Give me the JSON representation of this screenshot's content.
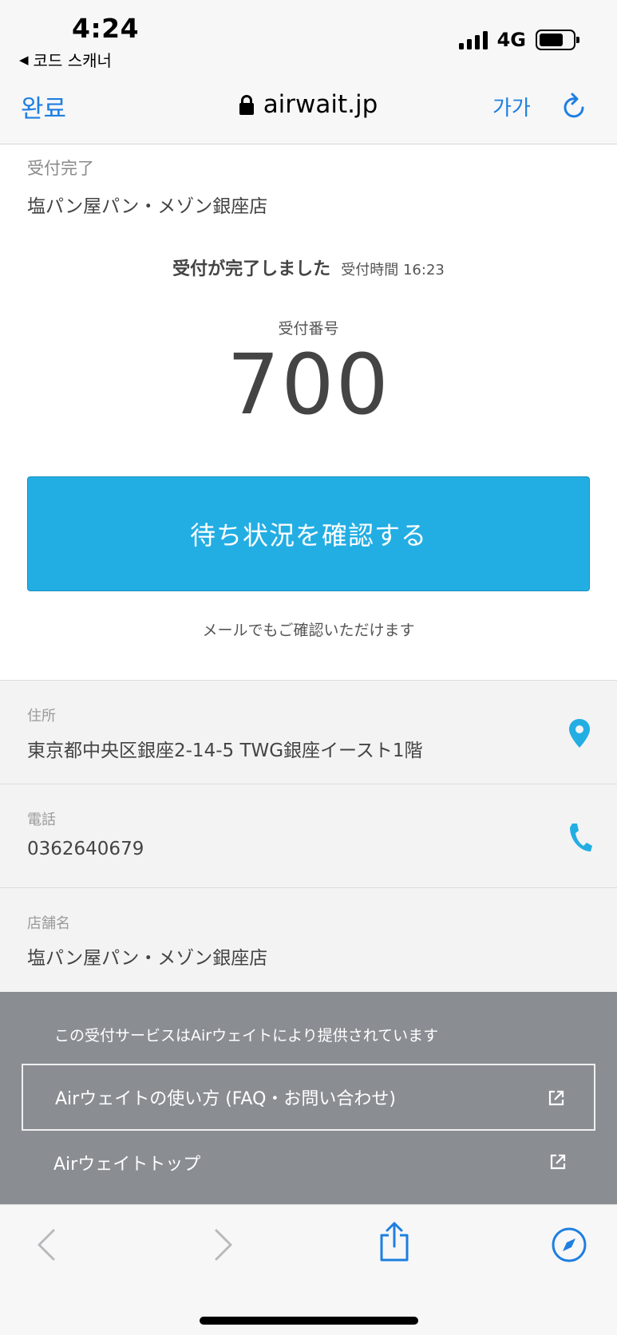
{
  "status_bar": {
    "time": "4:24",
    "back_app": "코드 스캐너",
    "network": "4G",
    "battery_level": 0.72
  },
  "browser": {
    "done_label": "완료",
    "url": "airwait.jp",
    "text_size_label": "가가"
  },
  "page": {
    "breadcrumb": "受付完了",
    "shop_title": "塩パン屋パン・メゾン銀座店",
    "completion_message": "受付が完了しました",
    "reception_time": "受付時間 16:23",
    "number_label": "受付番号",
    "number": "700",
    "check_button": "待ち状況を確認する",
    "mail_note": "メールでもご確認いただけます"
  },
  "info": [
    {
      "label": "住所",
      "value": "東京都中央区銀座2-14-5 TWG銀座イースト1階",
      "icon": "map-pin-icon"
    },
    {
      "label": "電話",
      "value": "0362640679",
      "icon": "phone-icon"
    },
    {
      "label": "店舗名",
      "value": "塩パン屋パン・メゾン銀座店",
      "icon": ""
    }
  ],
  "footer": {
    "note": "この受付サービスはAirウェイトにより提供されています",
    "faq_link": "Airウェイトの使い方 (FAQ・お問い合わせ)",
    "top_link": "Airウェイトトップ"
  },
  "colors": {
    "accent": "#23aee3",
    "ios_blue": "#1d7fe0",
    "footer_bg": "#8a8e93"
  }
}
